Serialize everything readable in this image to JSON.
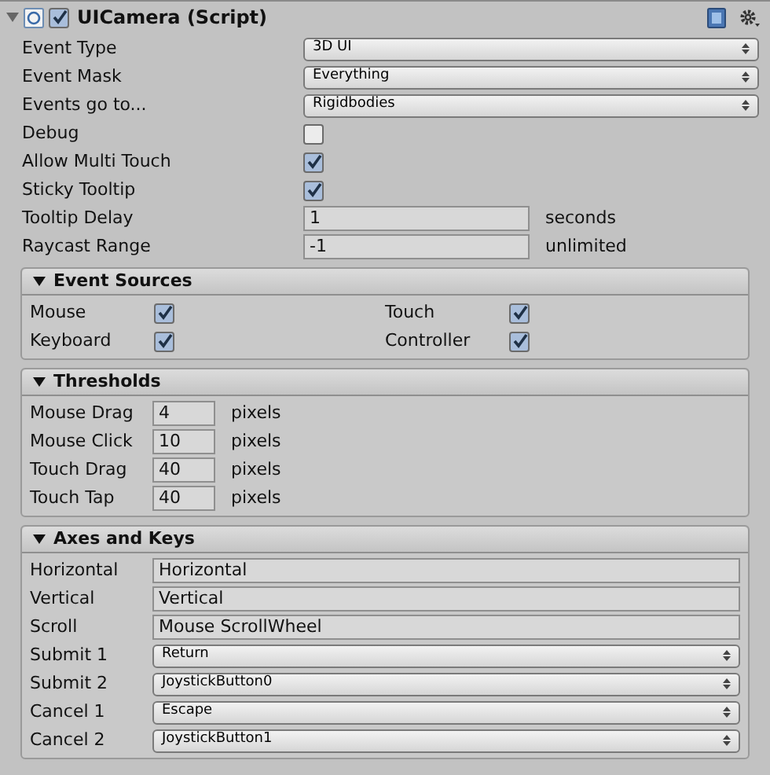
{
  "component": {
    "title": "UICamera (Script)",
    "expanded": true,
    "enabled": true
  },
  "fields": [
    {
      "label": "Event Type",
      "kind": "popup",
      "value": "3D UI"
    },
    {
      "label": "Event Mask",
      "kind": "popup",
      "value": "Everything"
    },
    {
      "label": "Events go to...",
      "kind": "popup",
      "value": "Rigidbodies"
    },
    {
      "label": "Debug",
      "kind": "checkbox",
      "checked": false
    },
    {
      "label": "Allow Multi Touch",
      "kind": "checkbox",
      "checked": true
    },
    {
      "label": "Sticky Tooltip",
      "kind": "checkbox",
      "checked": true
    },
    {
      "label": "Tooltip Delay",
      "kind": "number",
      "value": "1",
      "suffix": "seconds"
    },
    {
      "label": "Raycast Range",
      "kind": "number",
      "value": "-1",
      "suffix": "unlimited"
    }
  ],
  "sections": [
    {
      "title": "Event Sources",
      "expanded": true,
      "kind": "toggles",
      "items": [
        {
          "label": "Mouse",
          "checked": true
        },
        {
          "label": "Touch",
          "checked": true
        },
        {
          "label": "Keyboard",
          "checked": true
        },
        {
          "label": "Controller",
          "checked": true
        }
      ]
    },
    {
      "title": "Thresholds",
      "expanded": true,
      "kind": "fields",
      "fields": [
        {
          "label": "Mouse Drag",
          "kind": "number",
          "value": "4",
          "suffix": "pixels"
        },
        {
          "label": "Mouse Click",
          "kind": "number",
          "value": "10",
          "suffix": "pixels"
        },
        {
          "label": "Touch Drag",
          "kind": "number",
          "value": "40",
          "suffix": "pixels"
        },
        {
          "label": "Touch Tap",
          "kind": "number",
          "value": "40",
          "suffix": "pixels"
        }
      ]
    },
    {
      "title": "Axes and Keys",
      "expanded": true,
      "kind": "fields",
      "fields": [
        {
          "label": "Horizontal",
          "kind": "text",
          "value": "Horizontal"
        },
        {
          "label": "Vertical",
          "kind": "text",
          "value": "Vertical"
        },
        {
          "label": "Scroll",
          "kind": "text",
          "value": "Mouse ScrollWheel"
        },
        {
          "label": "Submit 1",
          "kind": "popup",
          "value": "Return"
        },
        {
          "label": "Submit 2",
          "kind": "popup",
          "value": "JoystickButton0"
        },
        {
          "label": "Cancel 1",
          "kind": "popup",
          "value": "Escape"
        },
        {
          "label": "Cancel 2",
          "kind": "popup",
          "value": "JoystickButton1"
        }
      ]
    }
  ]
}
